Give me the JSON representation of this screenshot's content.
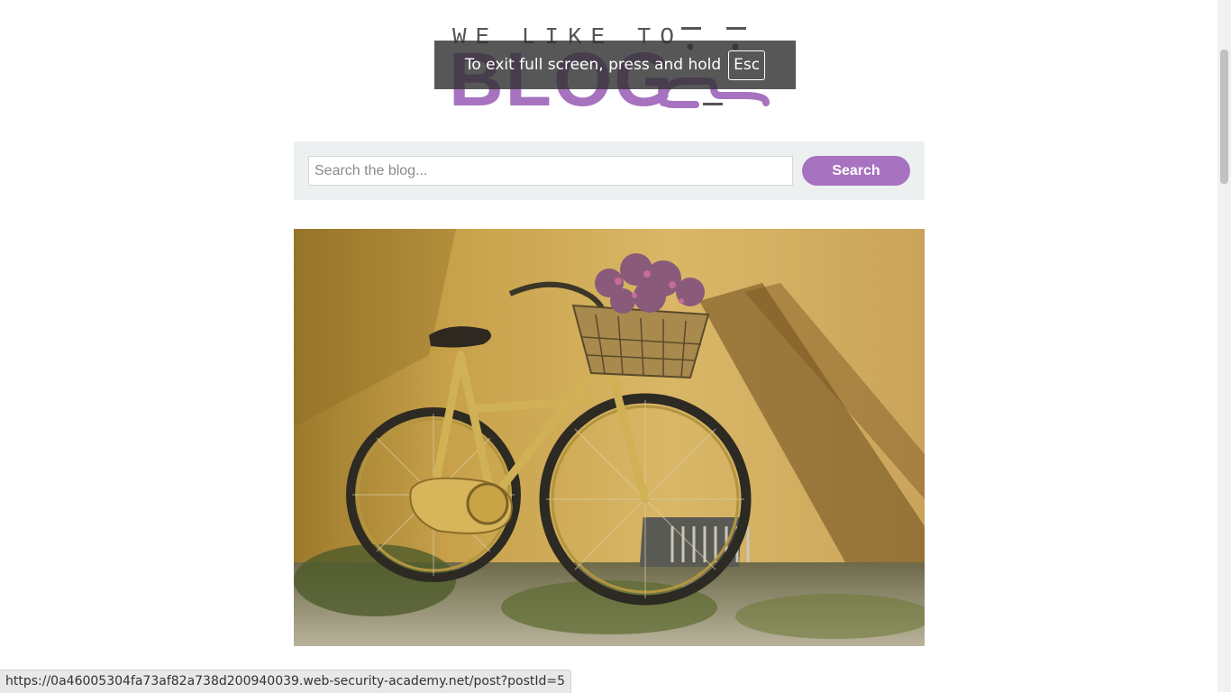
{
  "header": {
    "logo_top_text": "WE LIKE TO",
    "logo_bottom_text": "BLOG"
  },
  "fullscreen_notice": {
    "text": "To exit full screen, press and hold",
    "key": "Esc"
  },
  "search": {
    "placeholder": "Search the blog...",
    "value": "",
    "button_label": "Search"
  },
  "post": {
    "image_description_icon": "bicycle-photo"
  },
  "status_bar": {
    "url": "https://0a46005304fa73af82a738d200940039.web-security-academy.net/post?postId=5"
  },
  "colors": {
    "brand_purple": "#a772bf",
    "search_panel_bg": "#ecf0f1",
    "logo_gray": "#555555"
  }
}
